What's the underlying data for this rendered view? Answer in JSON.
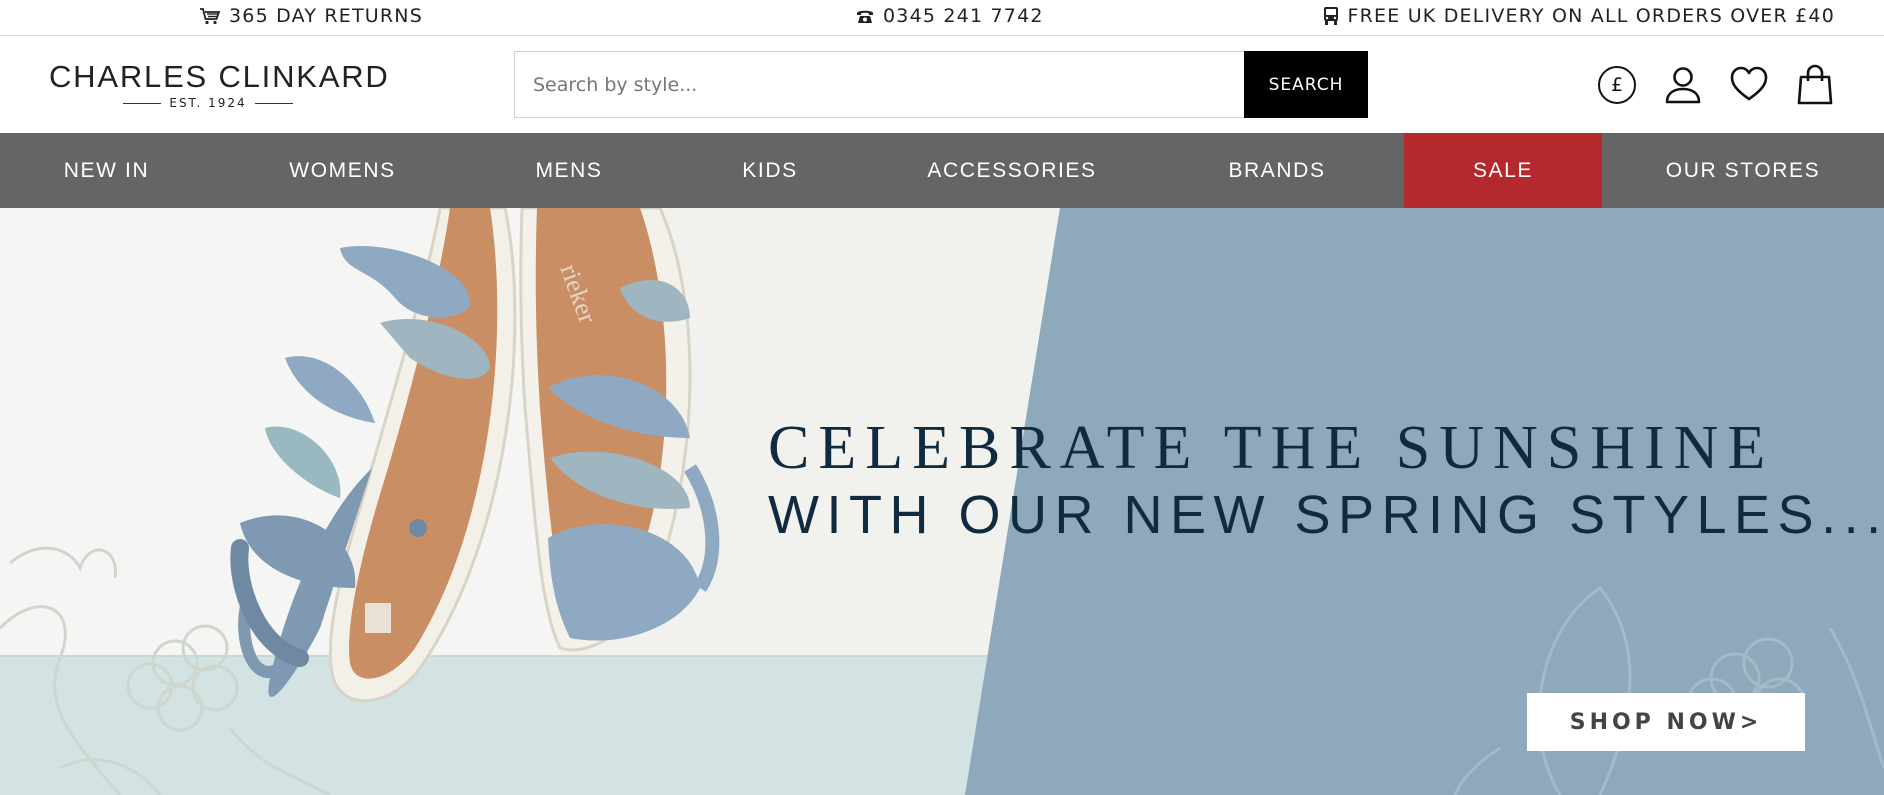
{
  "topbar": {
    "returns": {
      "icon": "cart-icon",
      "label": "365 DAY RETURNS"
    },
    "phone": {
      "icon": "phone-icon",
      "label": "0345 241 7742"
    },
    "delivery": {
      "icon": "truck-icon",
      "label": "FREE UK DELIVERY ON ALL ORDERS OVER £40"
    }
  },
  "header": {
    "logo": {
      "name": "CHARLES CLINKARD",
      "established": "EST. 1924"
    },
    "search": {
      "placeholder": "Search by style...",
      "value": "",
      "button_label": "SEARCH"
    },
    "icons": {
      "currency": {
        "icon": "currency-pound-icon",
        "symbol": "£"
      },
      "account": {
        "icon": "user-icon"
      },
      "wishlist": {
        "icon": "heart-icon"
      },
      "bag": {
        "icon": "shopping-bag-icon"
      }
    }
  },
  "nav": {
    "items": [
      {
        "label": "NEW IN"
      },
      {
        "label": "WOMENS"
      },
      {
        "label": "MENS"
      },
      {
        "label": "KIDS"
      },
      {
        "label": "ACCESSORIES"
      },
      {
        "label": "BRANDS"
      },
      {
        "label": "SALE"
      },
      {
        "label": "OUR STORES"
      }
    ],
    "sale_color": "#b3292d",
    "bar_color": "#656565"
  },
  "hero": {
    "headline_line1": "CELEBRATE THE SUNSHINE",
    "headline_line2": "WITH OUR NEW SPRING STYLES...",
    "cta_label": "SHOP NOW>",
    "image_description_icon": "sandals-image",
    "panel_color": "#8fa9bc",
    "text_color": "#102a40",
    "sandal_brand_mark": "rieker"
  }
}
